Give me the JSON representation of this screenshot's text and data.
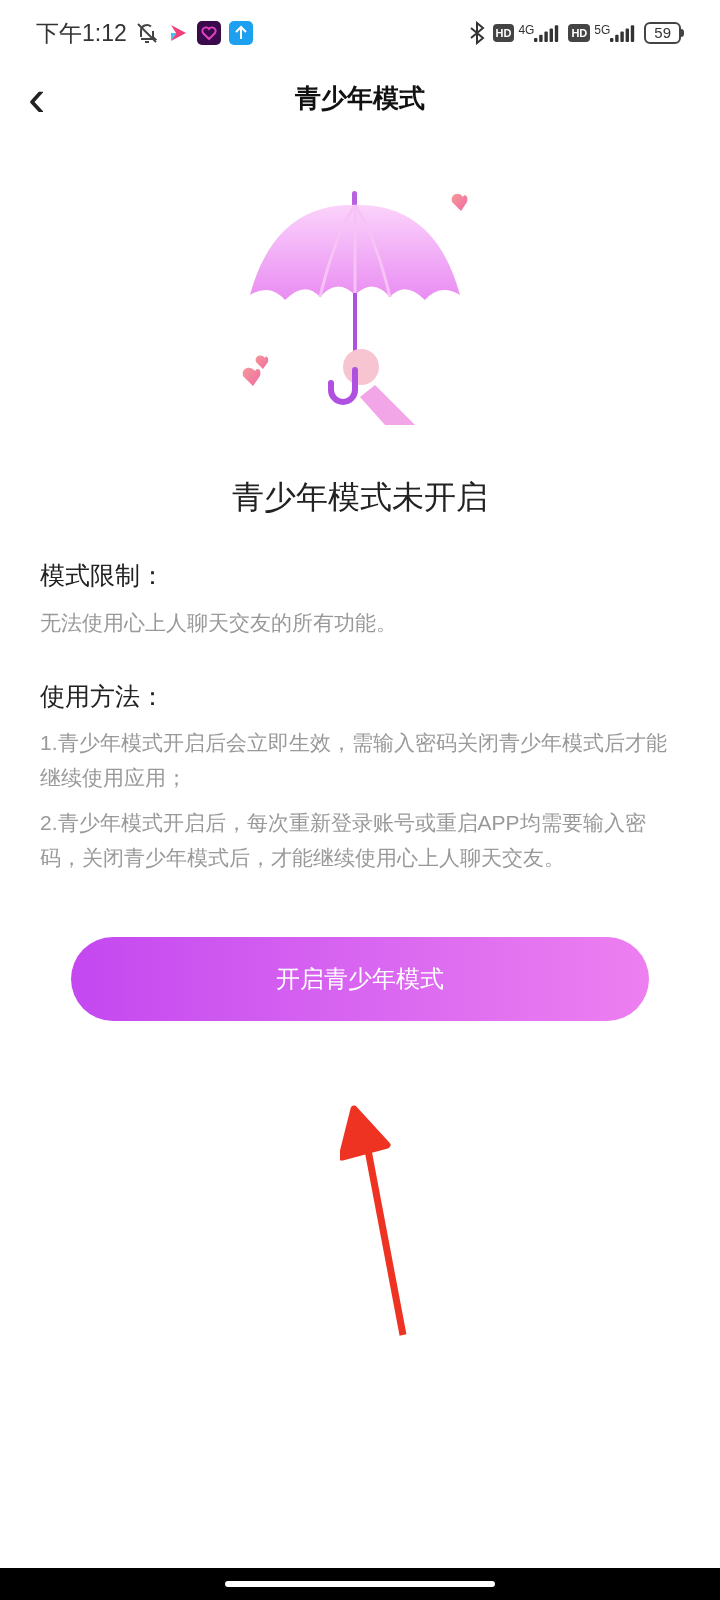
{
  "status_bar": {
    "time": "下午1:12",
    "badges": [
      "HD",
      "HD"
    ],
    "networks": [
      "4G",
      "5G"
    ],
    "battery": "59"
  },
  "header": {
    "back": "‹",
    "title": "青少年模式"
  },
  "status_title": "青少年模式未开启",
  "sections": [
    {
      "label": "模式限制：",
      "paragraphs": [
        "无法使用心上人聊天交友的所有功能。"
      ]
    },
    {
      "label": "使用方法：",
      "paragraphs": [
        "1.青少年模式开启后会立即生效，需输入密码关闭青少年模式后才能继续使用应用；",
        "2.青少年模式开启后，每次重新登录账号或重启APP均需要输入密码，关闭青少年模式后，才能继续使用心上人聊天交友。"
      ]
    }
  ],
  "button": {
    "label": "开启青少年模式"
  }
}
